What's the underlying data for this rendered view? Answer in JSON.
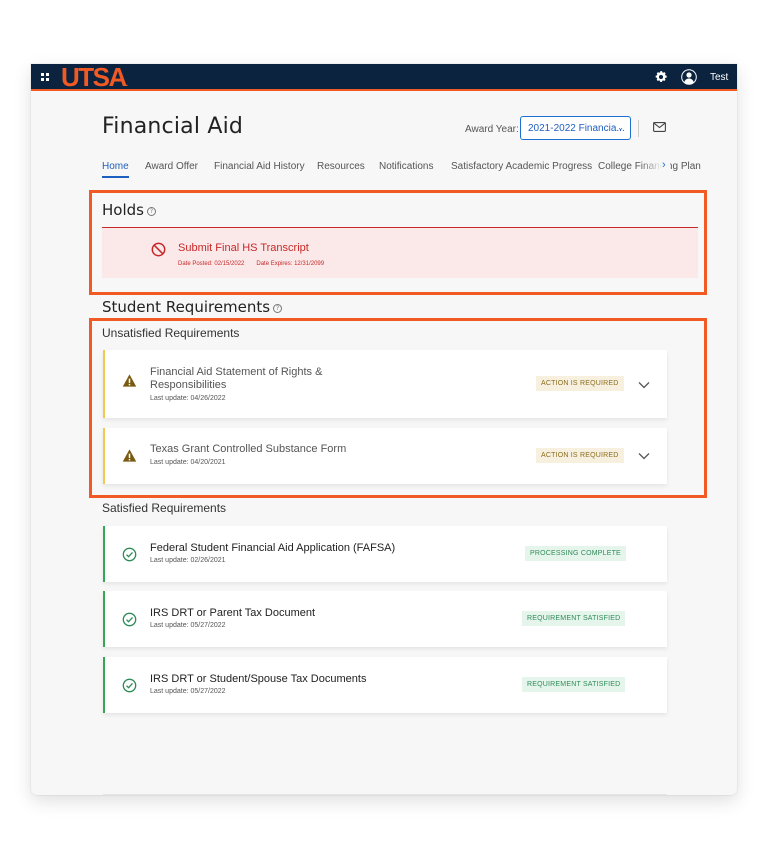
{
  "topbar": {
    "logo": "UTSA",
    "logo_mark": ".",
    "user_name": "Test",
    "icons": [
      "apps-grid-icon",
      "gear-icon",
      "user-avatar-icon"
    ]
  },
  "header": {
    "title": "Financial Aid",
    "award_year_label": "Award Year:",
    "award_year_value": "2021-2022 Financia...",
    "award_year_chevron": "⌄",
    "mail_icon": "mail-icon"
  },
  "tabs": [
    {
      "label": "Home",
      "active": true
    },
    {
      "label": "Award Offer",
      "active": false
    },
    {
      "label": "Financial Aid History",
      "active": false
    },
    {
      "label": "Resources",
      "active": false
    },
    {
      "label": "Notifications",
      "active": false
    },
    {
      "label": "Satisfactory Academic Progress",
      "active": false
    },
    {
      "label": "College Financing Plan",
      "active": false
    }
  ],
  "tabs_next": "›",
  "holds": {
    "title": "Holds",
    "help": "?",
    "items": [
      {
        "title": "Submit Final HS Transcript",
        "date_posted": "Date Posted: 02/15/2022",
        "date_expires": "Date Expires: 12/31/2099",
        "icon": "prohibited-icon"
      }
    ]
  },
  "student_requirements": {
    "title": "Student Requirements",
    "help": "?",
    "unsatisfied": {
      "title": "Unsatisfied Requirements",
      "items": [
        {
          "title_line1": "Financial Aid Statement of Rights &",
          "title_line2": "Responsibilities",
          "updated": "Last update: 04/26/2022",
          "status": "ACTION IS REQUIRED"
        },
        {
          "title_line1": "Texas Grant Controlled Substance Form",
          "title_line2": "",
          "updated": "Last update: 04/20/2021",
          "status": "ACTION IS REQUIRED"
        }
      ]
    },
    "satisfied": {
      "title": "Satisfied Requirements",
      "items": [
        {
          "title": "Federal Student Financial Aid Application (FAFSA)",
          "updated": "Last update: 02/26/2021",
          "status": "PROCESSING COMPLETE"
        },
        {
          "title": "IRS DRT or Parent Tax Document",
          "updated": "Last update: 05/27/2022",
          "status": "REQUIREMENT SATISFIED"
        },
        {
          "title": "IRS DRT or Student/Spouse Tax Documents",
          "updated": "Last update: 05/27/2022",
          "status": "REQUIREMENT SATISFIED"
        }
      ]
    }
  },
  "colors": {
    "brand_navy": "#0c2340",
    "brand_orange": "#f15a22",
    "link_blue": "#1f5fbf",
    "hold_red": "#c62828",
    "warning_yellow": "#f2c94c",
    "success_green": "#34a853"
  }
}
